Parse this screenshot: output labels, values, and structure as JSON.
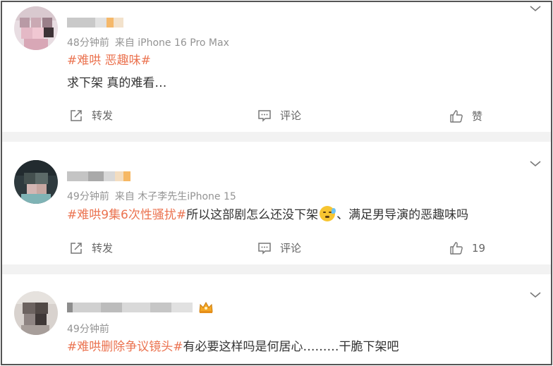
{
  "posts": [
    {
      "meta_time": "48分钟前",
      "meta_source": "来自 iPhone 16 Pro Max",
      "topic": "#难哄 恶趣味#",
      "body": "求下架 真的难看…",
      "actions": {
        "repost": "转发",
        "comment": "评论",
        "like": "赞"
      }
    },
    {
      "meta_time": "49分钟前",
      "meta_source": "来自 木子李先生iPhone 15",
      "topic": "#难哄9集6次性骚扰#",
      "body_before_emoji": "所以这部剧怎么还没下架",
      "body_after_emoji": "、满足男导演的恶趣味吗",
      "actions": {
        "repost": "转发",
        "comment": "评论",
        "like": "19"
      }
    },
    {
      "meta_time": "49分钟前",
      "topic": "#难哄删除争议镜头#",
      "body": "有必要这样吗是何居心………干脆下架吧"
    }
  ],
  "icons": {
    "repost": "repost-icon",
    "comment": "comment-icon",
    "like": "thumbs-up-icon",
    "more": "chevron-down-icon",
    "emoji": "sweat-face-emoji",
    "badge": "crown-badge-icon"
  },
  "colors": {
    "topic": "#eb7350",
    "meta": "#939393",
    "separator": "#f2f2f2"
  }
}
